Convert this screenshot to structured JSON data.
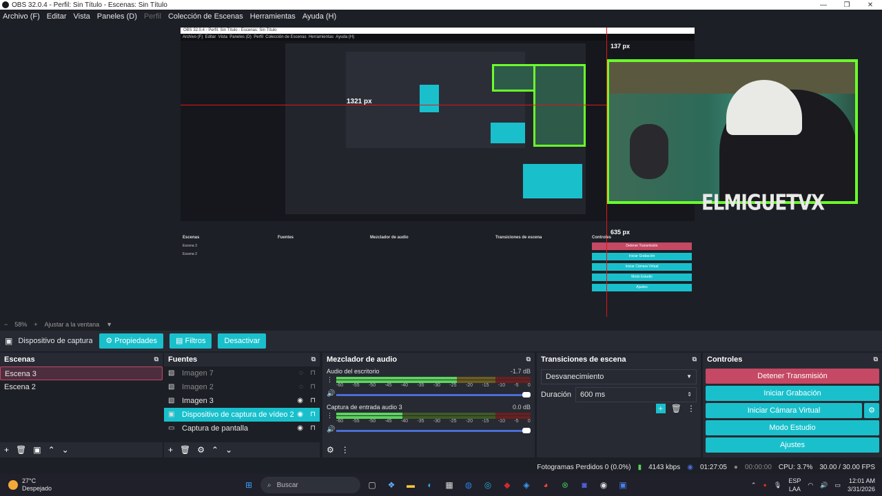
{
  "window": {
    "title": "OBS 32.0.4 - Perfil: Sin Título - Escenas: Sin Título"
  },
  "menu": {
    "items": [
      {
        "label": "Archivo (F)",
        "enabled": true
      },
      {
        "label": "Editar",
        "enabled": true
      },
      {
        "label": "Vista",
        "enabled": true
      },
      {
        "label": "Paneles (D)",
        "enabled": true
      },
      {
        "label": "Perfil",
        "enabled": false
      },
      {
        "label": "Colección de Escenas",
        "enabled": true
      },
      {
        "label": "Herramientas",
        "enabled": true
      },
      {
        "label": "Ayuda (H)",
        "enabled": true
      }
    ]
  },
  "preview": {
    "measure_top": "137 px",
    "measure_left": "1321 px",
    "measure_bottom": "635 px",
    "overlay_brand": "ELMIGUETVX",
    "zoom": "58%",
    "fit_label": "Ajustar a la ventana"
  },
  "source_toolbar": {
    "source_name": "Dispositivo de captura de v",
    "properties": "Propiedades",
    "filters": "Filtros",
    "deactivate": "Desactivar"
  },
  "scenes": {
    "title": "Escenas",
    "items": [
      {
        "label": "Escena 3",
        "selected": true
      },
      {
        "label": "Escena 2",
        "selected": false
      }
    ]
  },
  "sources": {
    "title": "Fuentes",
    "items": [
      {
        "label": "Imagen 7",
        "icon": "image-icon",
        "visible": false
      },
      {
        "label": "Imagen 2",
        "icon": "image-icon",
        "visible": false
      },
      {
        "label": "Imagen 3",
        "icon": "image-icon",
        "visible": true
      },
      {
        "label": "Dispositivo de captura de vídeo 2",
        "icon": "camera-icon",
        "visible": true,
        "selected": true
      },
      {
        "label": "Captura de pantalla",
        "icon": "monitor-icon",
        "visible": true
      }
    ]
  },
  "mixer": {
    "title": "Mezclador de audio",
    "tracks": [
      {
        "name": "Audio del escritorio",
        "db": "-1.7 dB",
        "level": 0.62
      },
      {
        "name": "Captura de entrada audio 3",
        "db": "0.0 dB",
        "level": 0.34
      }
    ],
    "scale": [
      "-60",
      "-55",
      "-50",
      "-45",
      "-40",
      "-35",
      "-30",
      "-25",
      "-20",
      "-15",
      "-10",
      "-5",
      "0"
    ]
  },
  "transitions": {
    "title": "Transiciones de escena",
    "selected": "Desvanecimiento",
    "duration_label": "Duración",
    "duration_value": "600 ms"
  },
  "controls": {
    "title": "Controles",
    "stop_stream": "Detener Transmisión",
    "start_record": "Iniciar Grabación",
    "virtual_cam": "Iniciar Cámara Virtual",
    "studio_mode": "Modo Estudio",
    "settings": "Ajustes"
  },
  "status": {
    "dropped": "Fotogramas Perdidos 0 (0.0%)",
    "bitrate": "4143 kbps",
    "stream_time": "01:27:05",
    "rec_time": "00:00:00",
    "cpu": "CPU: 3.7%",
    "fps": "30.00 / 30.00 FPS"
  },
  "taskbar": {
    "temp": "27°C",
    "weather": "Despejado",
    "search_placeholder": "Buscar",
    "lang1": "ESP",
    "lang2": "LAA",
    "time": "12:01 AM",
    "date": "3/31/2026"
  },
  "colors": {
    "accent": "#19c0cc",
    "danger": "#c54864",
    "frame_green": "#6bff2a",
    "measure_red": "#e01616"
  }
}
